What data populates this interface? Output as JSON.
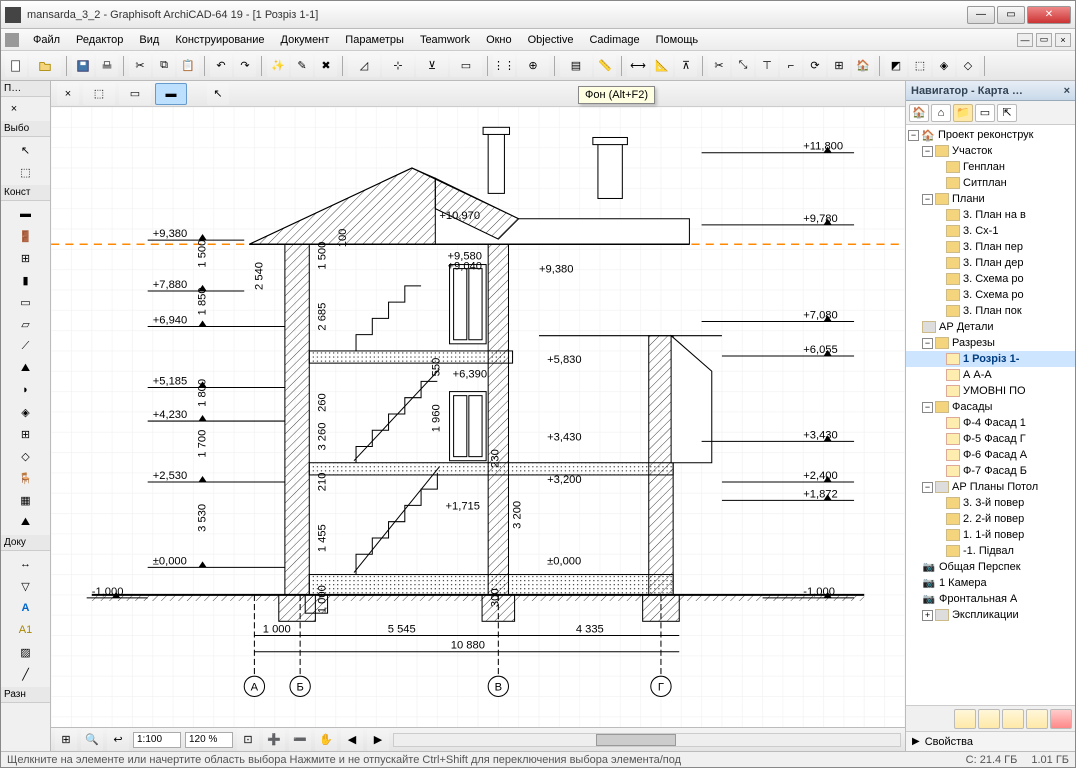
{
  "window": {
    "title": "mansarda_3_2 - Graphisoft ArchiCAD-64 19 - [1 Розріз 1-1]"
  },
  "menu": [
    "Файл",
    "Редактор",
    "Вид",
    "Конструирование",
    "Документ",
    "Параметры",
    "Teamwork",
    "Окно",
    "Objective",
    "Cadimage",
    "Помощь"
  ],
  "tooltip": "Фон (Alt+F2)",
  "left_panel": {
    "section1": "П…",
    "section2": "Выбо",
    "section3": "Конст",
    "section4": "Доку",
    "section5": "Разн"
  },
  "bottom": {
    "scale": "1:100",
    "zoom": "120 %"
  },
  "navigator": {
    "title": "Навигатор - Карта …",
    "root": "Проект реконструк",
    "nodes": {
      "n1": "Участок",
      "n1a": "Генплан",
      "n1b": "Ситплан",
      "n2": "Плани",
      "n2a": "3. План на в",
      "n2b": "3. Сх-1",
      "n2c": "3. План пер",
      "n2d": "3. План дер",
      "n2e": "3. Схема ро",
      "n2f": "3. Схема ро",
      "n2g": "3. План пок",
      "n3": "АР Детали",
      "n4": "Разрезы",
      "n4a": "1 Розріз 1-",
      "n4b": "А А-А",
      "n4c": "УМОВНІ ПО",
      "n5": "Фасады",
      "n5a": "Ф-4 Фасад 1",
      "n5b": "Ф-5 Фасад Г",
      "n5c": "Ф-6 Фасад А",
      "n5d": "Ф-7 Фасад Б",
      "n6": "АР Планы Потол",
      "n6a": "3. 3-й повер",
      "n6b": "2. 2-й повер",
      "n6c": "1. 1-й повер",
      "n6d": "-1. Підвал",
      "n7": "Общая Перспек",
      "n8": "1 Камера",
      "n9": "Фронтальная А",
      "n10": "Экспликации"
    },
    "props": "Свойства"
  },
  "status": {
    "hint": "Щелкните на элементе или начертите область выбора Нажмите и не отпускайте Ctrl+Shift для переключения выбора элемента/под",
    "mem1": "C: 21.4 ГБ",
    "mem2": "1.01 ГБ"
  },
  "elevations": {
    "e1": "+11,800",
    "e2": "+9,780",
    "e3": "+9,380",
    "e4": "+9,380",
    "e5": "+7,880",
    "e6": "+6,940",
    "e7": "+7,080",
    "e8": "+6,055",
    "e9": "+5,830",
    "e10": "+5,185",
    "e11": "+4,230",
    "e12": "+3,430",
    "e13": "+3,430",
    "e14": "+3,200",
    "e15": "+2,530",
    "e16": "+2,400",
    "e17": "+1,872",
    "e18": "+1,715",
    "e19": "+6,390",
    "e20": "+9,580",
    "e21": "+9,040",
    "e22": "-1,000",
    "e23": "-1,000",
    "e24": "±0,000",
    "e25": "±0,000",
    "e26": "+10,970"
  },
  "dims_v": {
    "d1": "1 500",
    "d2": "1 850",
    "d3": "1 800",
    "d4": "1 700",
    "d5": "3 530",
    "d6": "1 000",
    "d7": "1 500",
    "d8": "100",
    "d9": "2 540",
    "d10": "2 685",
    "d11": "550",
    "d12": "260",
    "d13": "1 960",
    "d14": "3 260",
    "d15": "210",
    "d16": "1 455",
    "d17": "230",
    "d18": "3 200",
    "d19": "300"
  },
  "dims_h": {
    "h1": "1 000",
    "h2": "5 545",
    "h3": "4 335",
    "h4": "10 880"
  },
  "axes": {
    "a": "А",
    "b": "Б",
    "c": "В",
    "d": "Г"
  }
}
